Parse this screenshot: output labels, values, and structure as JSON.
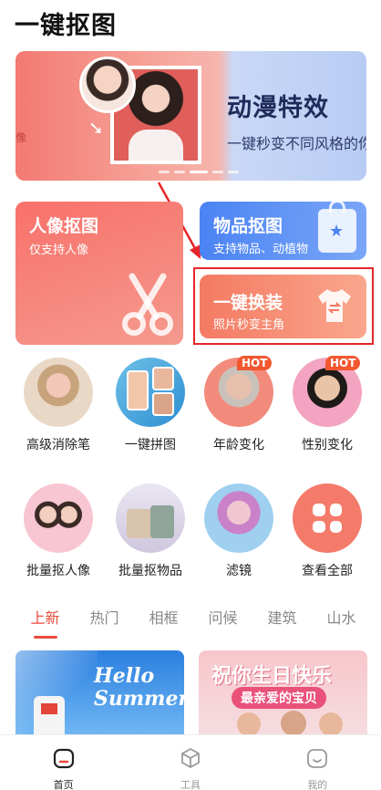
{
  "page": {
    "title": "一键抠图"
  },
  "banner": {
    "left_text": "像",
    "title": "动漫特效",
    "subtitle": "一键秒变不同风格的你"
  },
  "cards": {
    "portrait": {
      "title": "人像抠图",
      "subtitle": "仅支持人像"
    },
    "object": {
      "title": "物品抠图",
      "subtitle": "支持物品、动植物"
    },
    "outfit": {
      "title": "一键换装",
      "subtitle": "照片秒变主角"
    }
  },
  "tools": [
    {
      "label": "高级消除笔",
      "icon": "brush-portrait",
      "badge": ""
    },
    {
      "label": "一键拼图",
      "icon": "collage-photos",
      "badge": ""
    },
    {
      "label": "年龄变化",
      "icon": "old-woman-portrait",
      "badge": "HOT"
    },
    {
      "label": "性别变化",
      "icon": "man-portrait",
      "badge": "HOT"
    },
    {
      "label": "批量抠人像",
      "icon": "two-girls-portrait",
      "badge": ""
    },
    {
      "label": "批量抠物品",
      "icon": "handbags",
      "badge": ""
    },
    {
      "label": "滤镜",
      "icon": "filter-portrait",
      "badge": ""
    },
    {
      "label": "查看全部",
      "icon": "grid-icon",
      "badge": ""
    }
  ],
  "tabs": [
    "上新",
    "热门",
    "相框",
    "问候",
    "建筑",
    "山水"
  ],
  "active_tab": "上新",
  "thumbs": {
    "summer": {
      "text": "Hello Summer"
    },
    "birthday": {
      "title": "祝你生日快乐",
      "subtitle": "最亲爱的宝贝"
    }
  },
  "bottom_nav": [
    {
      "label": "首页",
      "icon": "home-icon",
      "active": true
    },
    {
      "label": "工具",
      "icon": "cube-icon",
      "active": false
    },
    {
      "label": "我的",
      "icon": "smile-icon",
      "active": false
    }
  ],
  "colors": {
    "accent": "#e94b3c",
    "highlight_border": "#e6252a",
    "hot_badge": "#f2572f"
  }
}
